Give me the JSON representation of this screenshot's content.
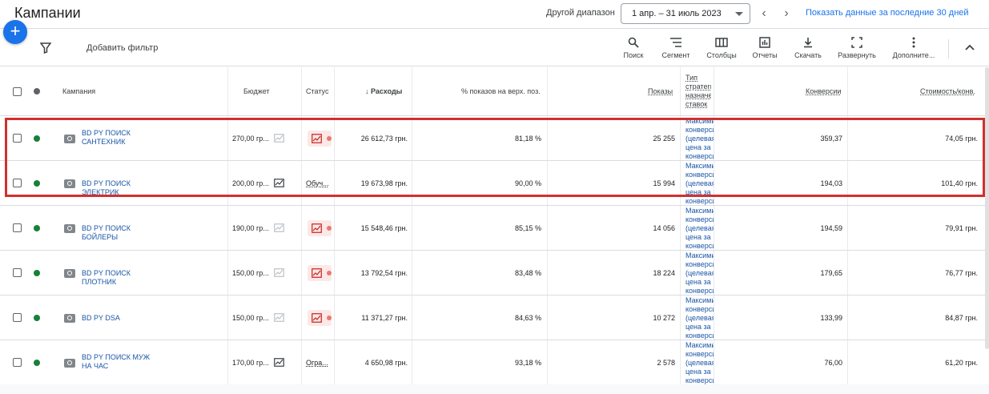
{
  "header": {
    "title": "Кампании",
    "range_label": "Другой диапазон",
    "date_range": "1 апр. – 31 июль 2023",
    "show_last_30": "Показать данные за последние 30 дней"
  },
  "toolbar": {
    "add_filter": "Добавить фильтр",
    "tools": [
      {
        "label": "Поиск",
        "icon": "search-icon"
      },
      {
        "label": "Сегмент",
        "icon": "segment-icon"
      },
      {
        "label": "Столбцы",
        "icon": "columns-icon"
      },
      {
        "label": "Отчеты",
        "icon": "reports-icon"
      },
      {
        "label": "Скачать",
        "icon": "download-icon"
      },
      {
        "label": "Развернуть",
        "icon": "expand-icon"
      },
      {
        "label": "Дополните...",
        "icon": "more-icon"
      }
    ]
  },
  "table": {
    "headers": {
      "campaign": "Кампания",
      "budget": "Бюджет",
      "status": "Статус",
      "cost": "Расходы",
      "top_impr": "% показов на верх. поз.",
      "impressions": "Показы",
      "bid_strategy": "Тип стратегии назначения ставок",
      "conversions": "Конверсии",
      "cost_per_conv": "Стоимость/конв."
    },
    "rows": [
      {
        "name": "BD PY ПОИСК САНТЕХНИК",
        "budget": "270,00 гр...",
        "status": "",
        "cost": "26 612,73 грн.",
        "top": "81,18 %",
        "impr": "25 255",
        "strategy": "Максимизация конверсий (целевая цена за конверсию)",
        "conv": "359,37",
        "cpc": "74,05 грн."
      },
      {
        "name": "BD PY ПОИСК ЭЛЕКТРИК",
        "budget": "200,00 гр...",
        "status": "Обуч...",
        "cost": "19 673,98 грн.",
        "top": "90,00 %",
        "impr": "15 994",
        "strategy": "Максимизация конверсий (целевая цена за конверсию)",
        "conv": "194,03",
        "cpc": "101,40 грн."
      },
      {
        "name": "BD PY ПОИСК БОЙЛЕРЫ",
        "budget": "190,00 гр...",
        "status": "",
        "cost": "15 548,46 грн.",
        "top": "85,15 %",
        "impr": "14 056",
        "strategy": "Максимизация конверсий (целевая цена за конверсию)",
        "conv": "194,59",
        "cpc": "79,91 грн."
      },
      {
        "name": "BD PY ПОИСК ПЛОТНИК",
        "budget": "150,00 гр...",
        "status": "",
        "cost": "13 792,54 грн.",
        "top": "83,48 %",
        "impr": "18 224",
        "strategy": "Максимизация конверсий (целевая цена за конверсию)",
        "conv": "179,65",
        "cpc": "76,77 грн."
      },
      {
        "name": "BD PY DSA",
        "budget": "150,00 гр...",
        "status": "",
        "cost": "11 371,27 грн.",
        "top": "84,63 %",
        "impr": "10 272",
        "strategy": "Максимизация конверсий (целевая цена за конверсию)",
        "conv": "133,99",
        "cpc": "84,87 грн."
      },
      {
        "name": "BD PY ПОИСК МУЖ НА ЧАС",
        "budget": "170,00 гр...",
        "status": "Огра...",
        "cost": "4 650,98 грн.",
        "top": "93,18 %",
        "impr": "2 578",
        "strategy": "Максимизация конверсий (целевая цена за конверсию)",
        "conv": "76,00",
        "cpc": "61,20 грн."
      }
    ]
  },
  "colors": {
    "accent": "#1a73e8",
    "status_dot": "#188038",
    "highlight": "#d32f2f"
  }
}
